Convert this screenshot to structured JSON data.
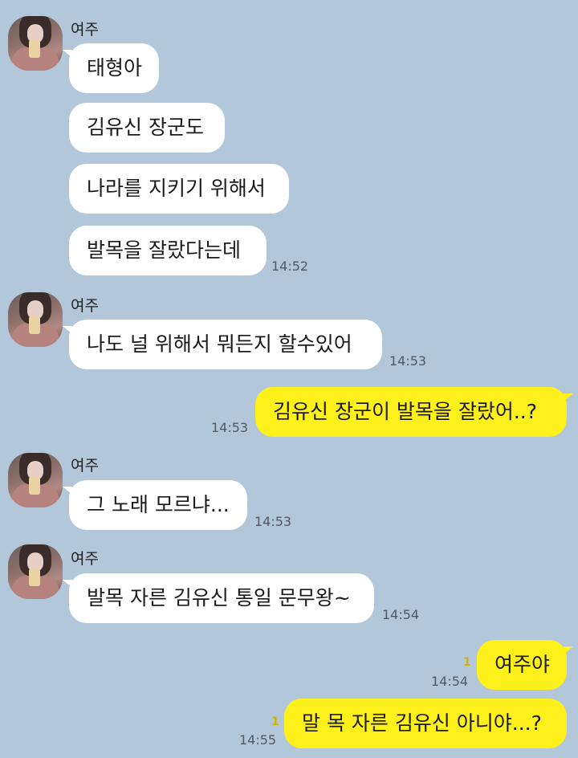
{
  "chat": {
    "sender_name": "여주",
    "messages": [
      {
        "text": "태형아"
      },
      {
        "text": "김유신 장군도"
      },
      {
        "text": "나라를 지키기 위해서"
      },
      {
        "text": "발목을 잘랐다는데",
        "time": "14:52"
      },
      {
        "text": "나도 널 위해서 뭐든지 할수있어",
        "time": "14:53"
      },
      {
        "text": "김유신 장군이 발목을 잘랐어..?",
        "time": "14:53"
      },
      {
        "text": "그 노래 모르냐...",
        "time": "14:53"
      },
      {
        "text": "발목 자른 김유신 통일 문무왕~",
        "time": "14:54"
      },
      {
        "text": "여주야",
        "time": "14:54",
        "unread": "1"
      },
      {
        "text": "말 목 자른 김유신 아니야...?",
        "time": "14:55",
        "unread": "1"
      }
    ]
  },
  "colors": {
    "background": "#b2c7da",
    "incoming_bubble": "#ffffff",
    "outgoing_bubble": "#fef01b",
    "unread_count": "#d4b400"
  }
}
